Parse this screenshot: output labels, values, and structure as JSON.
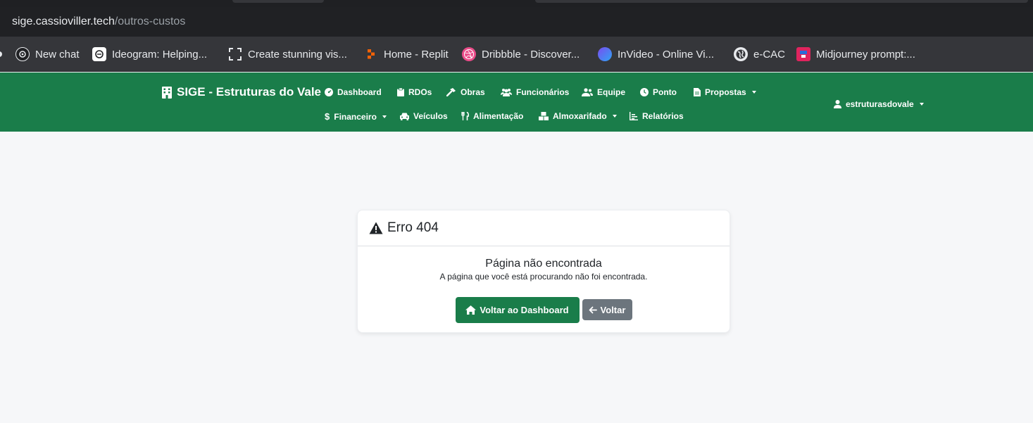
{
  "browser": {
    "url_host": "sige.cassioviller.tech",
    "url_path": "/outros-custos",
    "bookmarks": [
      {
        "label": "New chat",
        "icon": "openai-icon",
        "color": "#202124"
      },
      {
        "label": "Ideogram: Helping...",
        "icon": "ideogram-icon",
        "color": "#ffffff"
      },
      {
        "label": "Create stunning vis...",
        "icon": "frame-icon",
        "color": "#202124"
      },
      {
        "label": "Home - Replit",
        "icon": "replit-icon",
        "color": "#f26207"
      },
      {
        "label": "Dribbble - Discover...",
        "icon": "dribbble-icon",
        "color": "#ea4c89"
      },
      {
        "label": "InVideo - Online Vi...",
        "icon": "invideo-icon",
        "color": "#3a6bf0"
      },
      {
        "label": "e-CAC",
        "icon": "globe-icon",
        "color": "#e8eaed"
      },
      {
        "label": "Midjourney prompt:...",
        "icon": "midjourney-icon",
        "color": "#e0245e"
      }
    ]
  },
  "navbar": {
    "brand": "SIGE - Estruturas do Vale",
    "items_row1": [
      "Dashboard",
      "RDOs",
      "Obras",
      "Funcionários",
      "Equipe",
      "Ponto",
      "Propostas"
    ],
    "items_row2": [
      "Financeiro",
      "Veículos",
      "Alimentação",
      "Almoxarifado",
      "Relatórios"
    ],
    "user": "estruturasdovale",
    "accent": "#1a7d4a"
  },
  "card": {
    "title": "Erro 404",
    "heading": "Página não encontrada",
    "description": "A página que você está procurando não foi encontrada.",
    "primary_button": "Voltar ao Dashboard",
    "secondary_button": "Voltar"
  }
}
